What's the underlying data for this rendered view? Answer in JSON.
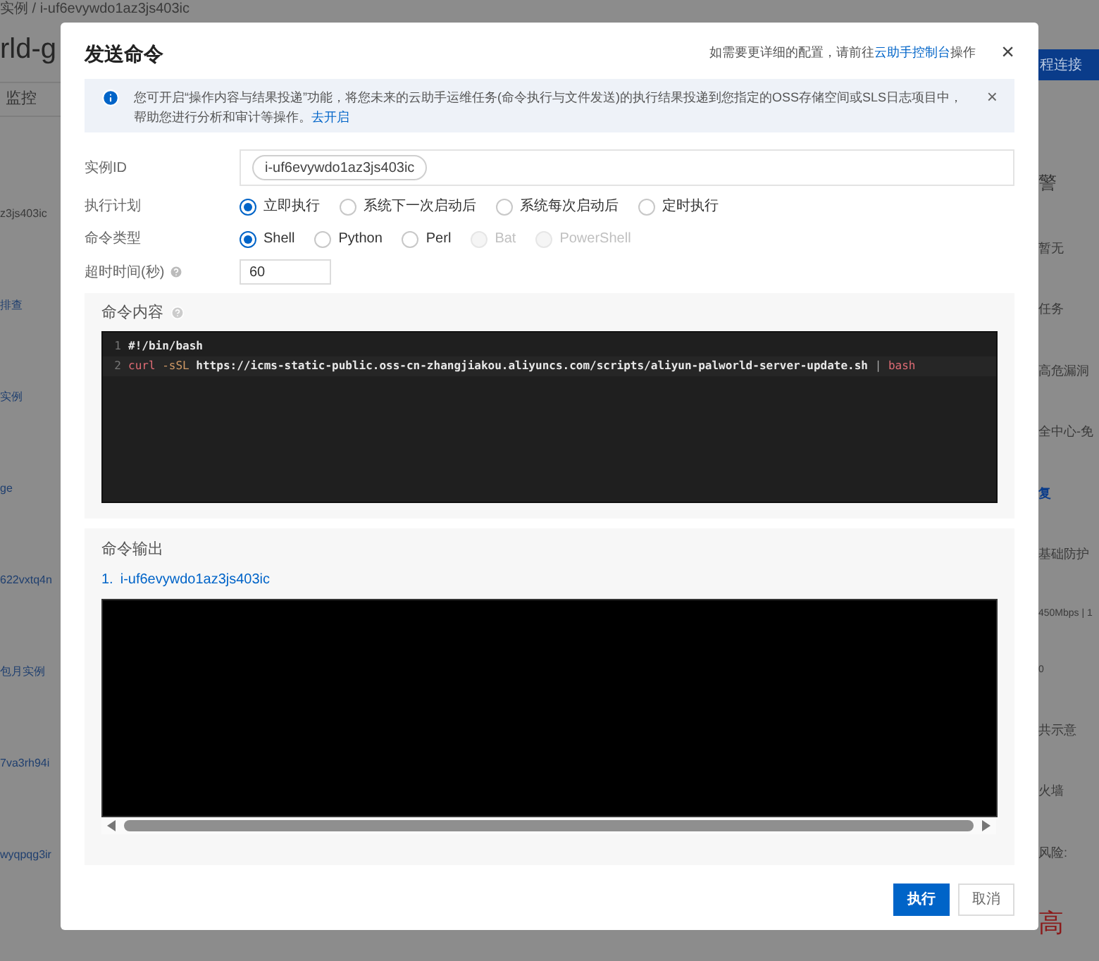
{
  "background": {
    "breadcrumb": [
      "实例",
      "/",
      "i-uf6evywdo1az3js403ic"
    ],
    "title": "rld-g",
    "tab": "监控",
    "connect_button": "程连接",
    "left_items": [
      {
        "text": "z3js403ic",
        "kind": "text"
      },
      {
        "text": "排查",
        "kind": "link"
      },
      {
        "text": "实例",
        "kind": "link"
      },
      {
        "text": "ge",
        "kind": "link"
      },
      {
        "text": "622vxtq4n",
        "kind": "link"
      },
      {
        "text": "包月实例",
        "kind": "link"
      },
      {
        "text": "7va3rh94i",
        "kind": "link"
      },
      {
        "text": "wyqpqg3ir",
        "kind": "link"
      }
    ],
    "right_items": [
      {
        "text": "警",
        "kind": "heading"
      },
      {
        "text": "暂无",
        "kind": "text"
      },
      {
        "text": "任务",
        "kind": "text"
      },
      {
        "text": "高危漏洞",
        "kind": "text"
      },
      {
        "text": "全中心-免",
        "kind": "text"
      },
      {
        "text": "复",
        "kind": "link"
      },
      {
        "text": "基础防护",
        "kind": "text"
      },
      {
        "text": "450Mbps | 1",
        "kind": "small"
      },
      {
        "text": "0",
        "kind": "small"
      },
      {
        "text": "共示意",
        "kind": "text"
      },
      {
        "text": "火墙",
        "kind": "text"
      },
      {
        "text": "风险:",
        "kind": "text"
      },
      {
        "text": "高",
        "kind": "danger"
      }
    ]
  },
  "dialog": {
    "title": "发送命令",
    "hint": "如需要更详细的配置，请前往",
    "hint_link": "云助手控制台",
    "hint_tail": "操作",
    "close": "×",
    "alert": {
      "text": "您可开启“操作内容与结果投递”功能，将您未来的云助手运维任务(命令执行与文件发送)的执行结果投递到您指定的OSS存储空间或SLS日志项目中，帮助您进行分析和审计等操作。",
      "link": "去开启",
      "close": "×"
    },
    "fields": [
      {
        "label": "实例ID",
        "kind": "tags",
        "tags": [
          "i-uf6evywdo1az3js403ic"
        ]
      },
      {
        "label": "执行计划",
        "kind": "radios",
        "options": [
          {
            "label": "立即执行",
            "selected": true,
            "disabled": false
          },
          {
            "label": "系统下一次启动后",
            "selected": false,
            "disabled": false
          },
          {
            "label": "系统每次启动后",
            "selected": false,
            "disabled": false
          },
          {
            "label": "定时执行",
            "selected": false,
            "disabled": false
          }
        ]
      },
      {
        "label": "命令类型",
        "kind": "radios",
        "options": [
          {
            "label": "Shell",
            "selected": true,
            "disabled": false
          },
          {
            "label": "Python",
            "selected": false,
            "disabled": false
          },
          {
            "label": "Perl",
            "selected": false,
            "disabled": false
          },
          {
            "label": "Bat",
            "selected": false,
            "disabled": true
          },
          {
            "label": "PowerShell",
            "selected": false,
            "disabled": true
          }
        ]
      },
      {
        "label": "超时时间(秒)",
        "kind": "input",
        "help": true,
        "value": "60"
      }
    ],
    "command": {
      "title": "命令内容",
      "lines": [
        {
          "number": "1",
          "tokens": [
            {
              "text": "#!/bin/bash",
              "kind": "comment"
            }
          ]
        },
        {
          "number": "2",
          "tokens": [
            {
              "text": "curl",
              "kind": "keyword"
            },
            {
              "text": "-sSL",
              "kind": "flag"
            },
            {
              "text": "https://icms-static-public.oss-cn-zhangjiakou.aliyuncs.com/scripts/aliyun-palworld-server-update.sh",
              "kind": "plain"
            },
            {
              "text": "|",
              "kind": "operator"
            },
            {
              "text": "bash",
              "kind": "keyword"
            }
          ]
        }
      ]
    },
    "output": {
      "title": "命令输出",
      "items": [
        {
          "number": "1.",
          "instance": "i-uf6evywdo1az3js403ic"
        }
      ]
    },
    "buttons": [
      {
        "label": "执行",
        "kind": "primary"
      },
      {
        "label": "取消",
        "kind": "secondary"
      }
    ]
  }
}
